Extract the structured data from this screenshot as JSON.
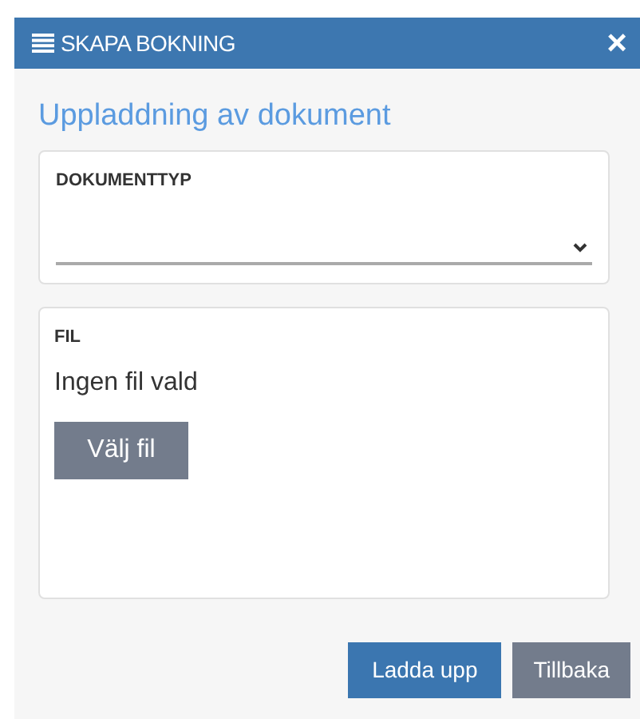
{
  "window": {
    "title": "SKAPA BOKNING",
    "close": "×"
  },
  "heading": "Uppladdning av dokument",
  "document_type": {
    "label": "DOKUMENTTYP"
  },
  "file": {
    "label": "FIL",
    "status": "Ingen fil vald",
    "button": "Välj fil"
  },
  "buttons": [
    {
      "label": "Ladda upp",
      "kind": "primary"
    },
    {
      "label": "Tillbaka",
      "kind": "secondary"
    }
  ]
}
